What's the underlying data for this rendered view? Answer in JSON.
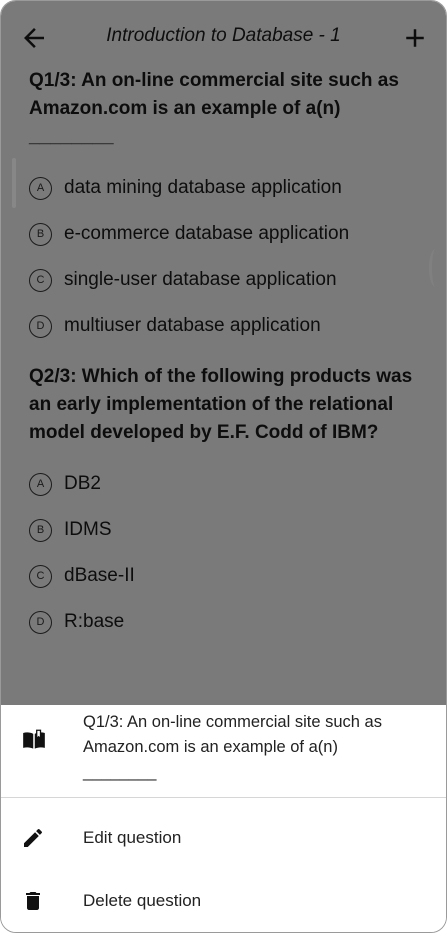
{
  "app_bar": {
    "title": "Introduction to Database - 1",
    "back_icon": "arrow-back-icon",
    "add_icon": "add-icon"
  },
  "questions": [
    {
      "text": "Q1/3: An on-line commercial site such as Amazon.com is an example of a(n)\n________",
      "options": [
        {
          "letter": "A",
          "text": "data mining database application"
        },
        {
          "letter": "B",
          "text": "e-commerce database application"
        },
        {
          "letter": "C",
          "text": "single-user database application"
        },
        {
          "letter": "D",
          "text": "multiuser database application"
        }
      ]
    },
    {
      "text": "Q2/3:   Which of the following products was an early implementation of the relational model developed by E.F. Codd of IBM?",
      "options": [
        {
          "letter": "A",
          "text": "DB2"
        },
        {
          "letter": "B",
          "text": "IDMS"
        },
        {
          "letter": "C",
          "text": "dBase-II"
        },
        {
          "letter": "D",
          "text": "R:base"
        }
      ]
    }
  ],
  "bottom_sheet": {
    "header_icon": "book-open-icon",
    "header_text": "Q1/3: An on-line commercial site such as Amazon.com is an example of a(n)\n________",
    "items": [
      {
        "label": "Edit question",
        "icon": "pencil-icon"
      },
      {
        "label": "Delete question",
        "icon": "trash-icon"
      }
    ]
  },
  "colors": {
    "scrim": "#000000",
    "screen_background": "#e6e6e6",
    "sheet_background": "#ffffff"
  }
}
